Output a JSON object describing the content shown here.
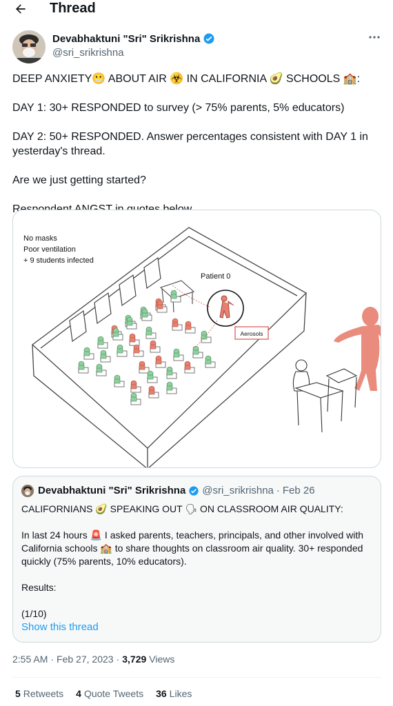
{
  "header": {
    "title": "Thread",
    "back_icon": "arrow-left-icon"
  },
  "author": {
    "name": "Devabhaktuni \"Sri\" Srikrishna",
    "handle": "@sri_srikrishna",
    "verified": true
  },
  "tweet": {
    "paragraphs": [
      "DEEP ANXIETY😬 ABOUT AIR ☣️ IN CALIFORNIA 🥑 SCHOOLS 🏫:",
      "DAY 1:  30+ RESPONDED to survey (> 75% parents, 5% educators)",
      "DAY 2: 50+ RESPONDED. Answer percentages consistent with DAY 1 in yesterday's thread.",
      "Are we just getting started?",
      "Respondent ANGST in quotes below."
    ]
  },
  "media": {
    "label_line1": "No masks",
    "label_line2": "Poor ventilation",
    "label_line3": "+ 9 students infected",
    "patient_label": "Patient 0",
    "aerosols_label": "Aerosols"
  },
  "quote": {
    "name": "Devabhaktuni \"Sri\" Srikrishna",
    "handle": "@sri_srikrishna",
    "separator": "·",
    "date": "Feb 26",
    "paragraphs": [
      "CALIFORNIANS 🥑 SPEAKING OUT 🗣 ON CLASSROOM AIR QUALITY:",
      "In last 24 hours 🚨 I asked parents, teachers, principals, and other involved with California schools 🏫 to share thoughts on classroom air quality. 30+ responded quickly (75% parents, 10% educators).",
      "Results:",
      "(1/10)"
    ],
    "show_thread": "Show this thread"
  },
  "meta": {
    "time": "2:55 AM",
    "separator": "·",
    "date": "Feb 27, 2023",
    "views_count": "3,729",
    "views_label": "Views"
  },
  "stats": {
    "retweets_count": "5",
    "retweets_label": "Retweets",
    "quotes_count": "4",
    "quotes_label": "Quote Tweets",
    "likes_count": "36",
    "likes_label": "Likes"
  },
  "colors": {
    "accent": "#1d9bf0",
    "secondary_text": "#536471",
    "infected": "#e8806f",
    "healthy": "#5fb37a"
  }
}
